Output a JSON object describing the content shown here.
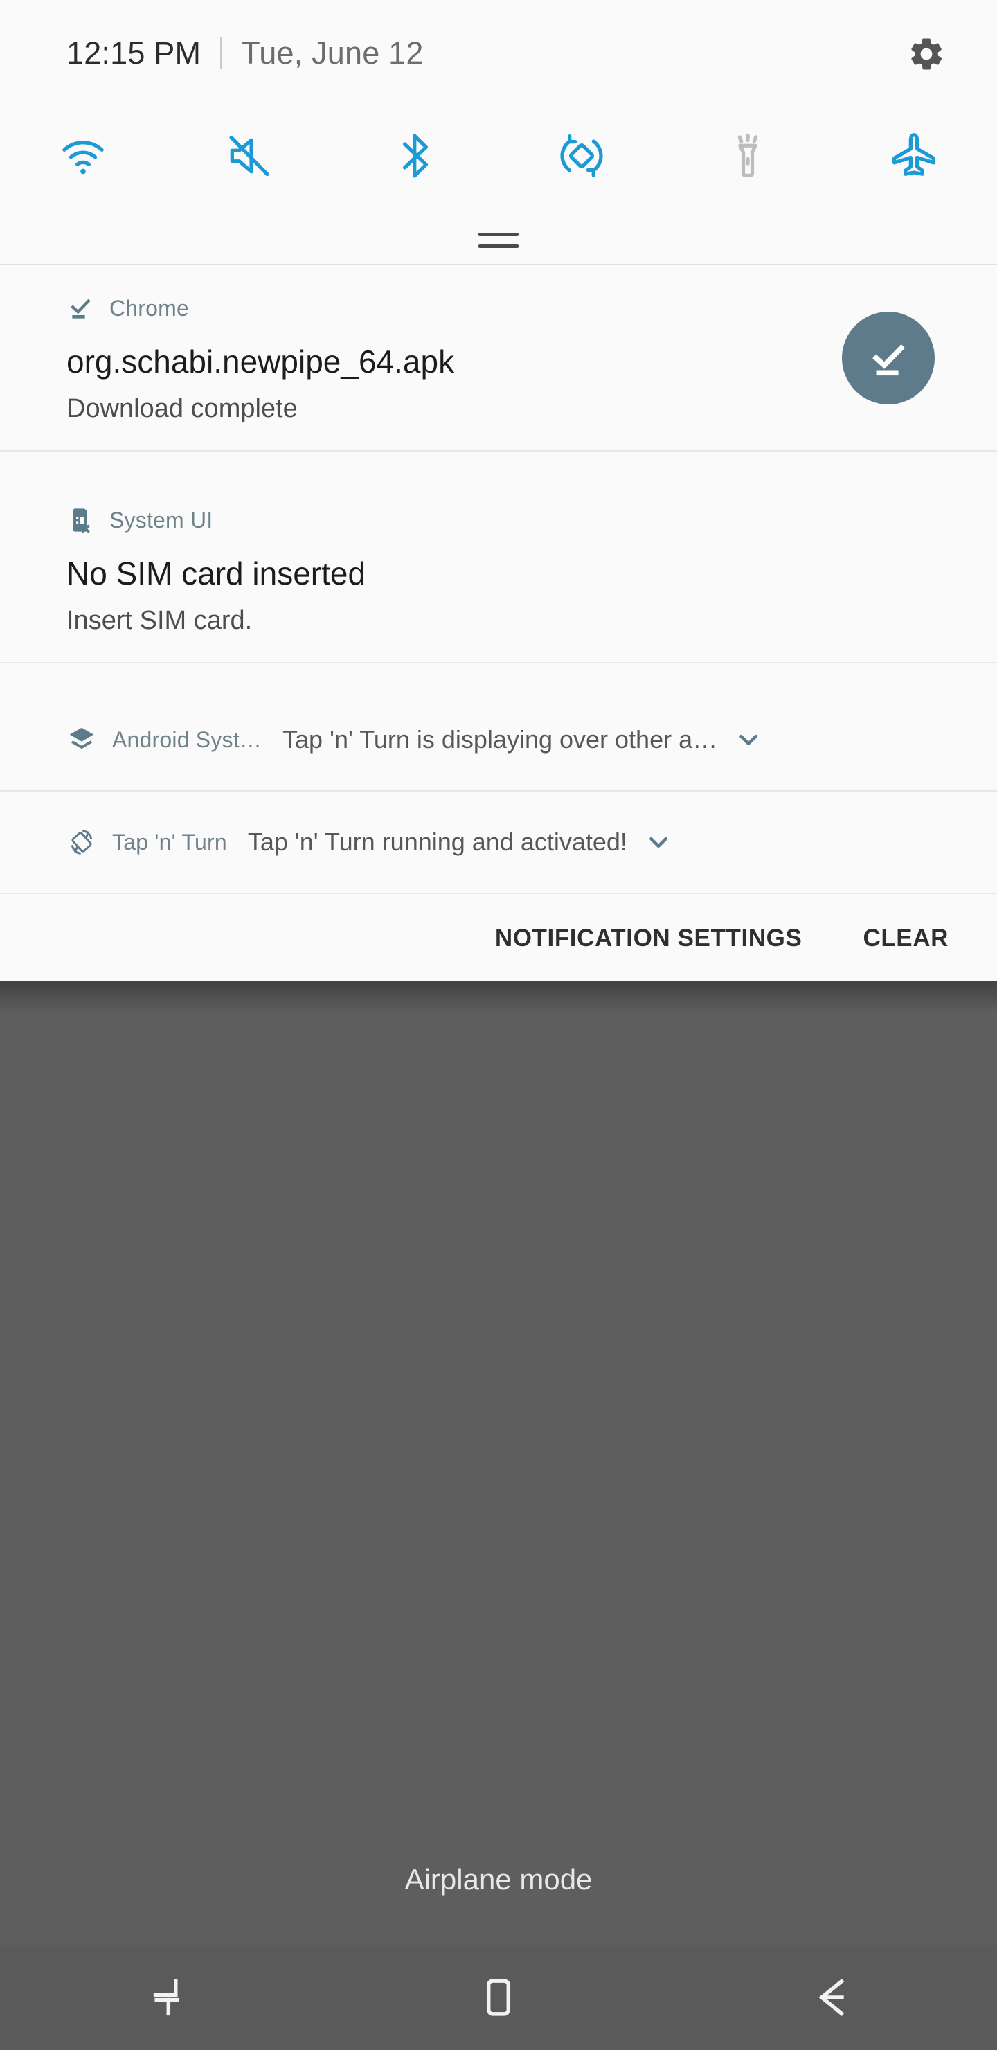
{
  "colors": {
    "shade_bg": "#fafafa",
    "wallpaper": "#5e5e5e",
    "navbar": "#5a5a5a",
    "accent_on": "#1c9ad6",
    "accent_off": "#bdbdbd",
    "app_label": "#6f8189",
    "download_circle": "#5d7b8a"
  },
  "status_bar": {
    "time": "12:15 PM",
    "date": "Tue, June 12",
    "settings_icon": "gear-icon"
  },
  "quick_settings": {
    "tiles": [
      {
        "name": "wifi",
        "icon": "wifi-icon",
        "state": "on"
      },
      {
        "name": "sound",
        "icon": "sound-mute-icon",
        "state": "on"
      },
      {
        "name": "bluetooth",
        "icon": "bluetooth-icon",
        "state": "on"
      },
      {
        "name": "auto-rotate",
        "icon": "auto-rotate-icon",
        "state": "on"
      },
      {
        "name": "flashlight",
        "icon": "flashlight-icon",
        "state": "off"
      },
      {
        "name": "airplane-mode",
        "icon": "airplane-icon",
        "state": "on"
      }
    ],
    "handle_icon": "drag-handle-icon"
  },
  "notifications": [
    {
      "id": "chrome-download",
      "style": "expanded",
      "app": "Chrome",
      "app_icon": "download-complete-icon",
      "title": "org.schabi.newpipe_64.apk",
      "text": "Download complete",
      "action_icon": "download-complete-icon"
    },
    {
      "id": "system-ui-sim",
      "style": "expanded",
      "app": "System UI",
      "app_icon": "sim-card-error-icon",
      "title": "No SIM card inserted",
      "text": "Insert SIM card."
    },
    {
      "id": "android-system-overlay",
      "style": "collapsed",
      "app": "Android Syst…",
      "app_icon": "layers-icon",
      "message": "Tap 'n' Turn is displaying over other a…",
      "expand_icon": "chevron-down-icon"
    },
    {
      "id": "tap-n-turn",
      "style": "collapsed",
      "app": "Tap 'n' Turn",
      "app_icon": "screen-rotation-icon",
      "message": "Tap 'n' Turn running and activated!",
      "expand_icon": "chevron-down-icon"
    }
  ],
  "footer": {
    "notification_settings": "NOTIFICATION SETTINGS",
    "clear": "CLEAR"
  },
  "toast": {
    "text": "Airplane mode"
  },
  "navbar": {
    "buttons": [
      {
        "name": "recents",
        "icon": "recents-icon"
      },
      {
        "name": "home",
        "icon": "home-icon"
      },
      {
        "name": "back",
        "icon": "back-arrow-icon"
      }
    ]
  }
}
